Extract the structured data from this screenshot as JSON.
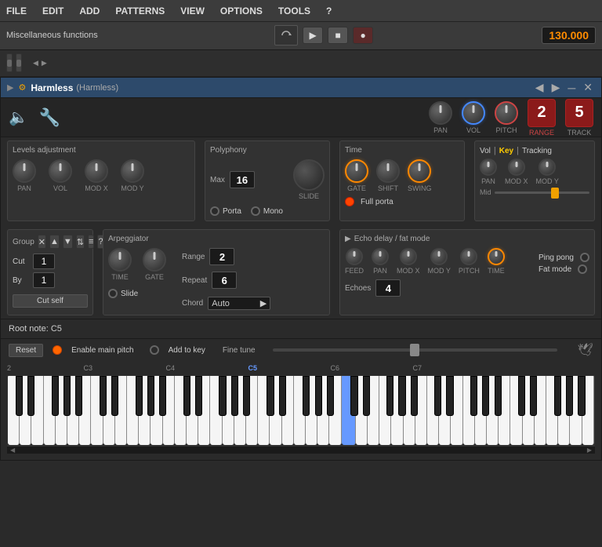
{
  "menubar": {
    "items": [
      "FILE",
      "EDIT",
      "ADD",
      "PATTERNS",
      "VIEW",
      "OPTIONS",
      "TOOLS",
      "?"
    ]
  },
  "transport": {
    "misc_label": "Miscellaneous functions",
    "bpm": "130.000"
  },
  "plugin": {
    "title": "Harmless",
    "subtitle": "(Harmless)"
  },
  "instrument_strip": {
    "pan_label": "PAN",
    "vol_label": "VOL",
    "pitch_label": "PITCH",
    "range_label": "RANGE",
    "track_label": "TRACK",
    "range_value": "2",
    "track_value": "5"
  },
  "levels": {
    "title": "Levels adjustment",
    "knobs": [
      {
        "label": "PAN"
      },
      {
        "label": "VOL"
      },
      {
        "label": "MOD X"
      },
      {
        "label": "MOD Y"
      }
    ]
  },
  "polyphony": {
    "title": "Polyphony",
    "max_label": "Max",
    "max_value": "16",
    "slide_label": "SLIDE",
    "porta_label": "Porta",
    "mono_label": "Mono"
  },
  "time": {
    "title": "Time",
    "gate_label": "GATE",
    "shift_label": "SHIFT",
    "swing_label": "SWING",
    "full_porta": "Full porta"
  },
  "vkt": {
    "vol_label": "Vol",
    "key_label": "Key",
    "tracking_label": "Tracking",
    "pan_label": "PAN",
    "mod_x_label": "MOD X",
    "mod_y_label": "MOD Y",
    "mid_label": "Mid"
  },
  "group": {
    "title": "Group",
    "cut_label": "Cut",
    "by_label": "By",
    "cut_value": "1",
    "by_value": "1",
    "cut_self": "Cut self"
  },
  "arpeggiator": {
    "title": "Arpeggiator",
    "time_label": "TIME",
    "gate_label": "GATE",
    "range_label": "Range",
    "range_value": "2",
    "repeat_label": "Repeat",
    "repeat_value": "6",
    "slide_label": "Slide",
    "chord_label": "Chord",
    "chord_value": "Auto"
  },
  "echo": {
    "title": "Echo delay / fat mode",
    "feed_label": "FEED",
    "pan_label": "PAN",
    "mod_x_label": "MOD X",
    "mod_y_label": "MOD Y",
    "pitch_label": "PITCH",
    "time_label": "TIME",
    "echoes_label": "Echoes",
    "echoes_value": "4",
    "ping_pong_label": "Ping pong",
    "fat_mode_label": "Fat mode"
  },
  "root_note": {
    "label": "Root note: C5"
  },
  "piano_controls": {
    "reset_label": "Reset",
    "enable_pitch_label": "Enable main pitch",
    "add_to_key_label": "Add to key",
    "fine_tune_label": "Fine tune"
  },
  "piano": {
    "note_labels": [
      "2",
      "C3",
      "C4",
      "C5",
      "C6",
      "C7",
      ""
    ]
  }
}
